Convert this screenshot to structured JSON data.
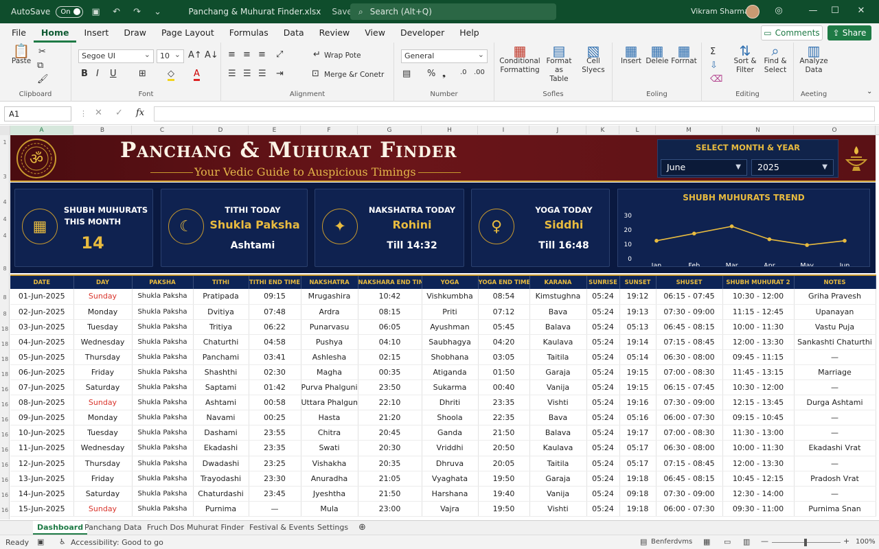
{
  "titlebar": {
    "autosave_label": "AutoSave",
    "autosave_state": "On",
    "doc_title": "Panchang & Muhurat Finder.xlsx",
    "doc_status": "Saved",
    "search_placeholder": "Search (Alt+Q)",
    "user_name": "Vikram Sharma"
  },
  "ribbon_tabs": [
    "File",
    "Home",
    "Insert",
    "Draw",
    "Page Layout",
    "Formulas",
    "Data",
    "Review",
    "View",
    "Developer",
    "Help"
  ],
  "actions": {
    "comments": "Comments",
    "share": "Share"
  },
  "ribbon": {
    "clipboard": {
      "paste": "Paste",
      "group": "Clipboard"
    },
    "font": {
      "name": "Segoe UI",
      "size": "10",
      "group": "Font"
    },
    "alignment": {
      "wrap": "Wrap Pote",
      "merge": "Merge &r Conetr",
      "group": "Alignment"
    },
    "number": {
      "format": "General",
      "group": "Number"
    },
    "styles": {
      "cond1": "Conditional",
      "cond2": "Formatting",
      "fmt1": "Format as",
      "fmt2": "Table",
      "cell1": "Cell",
      "cell2": "Slyecs",
      "group": "Sofles"
    },
    "cells": {
      "insert": "Insert",
      "delete": "Deleie",
      "format": "Forrnat",
      "group": "Eoling"
    },
    "editing": {
      "sort1": "Sort &",
      "sort2": "Filter",
      "find1": "Find &",
      "find2": "Select",
      "group": "Editing"
    },
    "analysis": {
      "analyze1": "Analyze",
      "analyze2": "Data",
      "group": "Aeeting"
    }
  },
  "formula_bar": {
    "name_box": "A1",
    "fx": "fx",
    "value": ""
  },
  "columns": [
    "A",
    "B",
    "C",
    "D",
    "E",
    "F",
    "G",
    "H",
    "I",
    "J",
    "K",
    "L",
    "M",
    "N",
    "O"
  ],
  "row_numbers": [
    "1",
    "3",
    "4",
    "4",
    "4",
    "8",
    "8",
    "8",
    "18",
    "18",
    "18",
    "18",
    "16",
    "16",
    "16",
    "16",
    "16",
    "16",
    "16",
    "16",
    "16"
  ],
  "banner": {
    "title": "Panchang & Muhurat Finder",
    "subtitle": "Your Vedic Guide to Auspicious Timings",
    "select_label": "SELECT MONTH & YEAR",
    "month": "June",
    "year": "2025",
    "om_symbol": "ॐ"
  },
  "kpis": {
    "muhurat": {
      "title1": "SHUBH MUHURATS",
      "title2": "THIS MONTH",
      "value": "14",
      "icon": "calendar-icon"
    },
    "tithi": {
      "title": "TITHI TODAY",
      "value": "Shukla Paksha",
      "sub": "Ashtami",
      "icon": "moon-icon"
    },
    "nakshatra": {
      "title": "NAKSHATRA TODAY",
      "value": "Rohini",
      "sub": "Till 14:32",
      "icon": "stars-icon"
    },
    "yoga": {
      "title": "YOGA TODAY",
      "value": "Siddhi",
      "sub": "Till 16:48",
      "icon": "meditation-icon"
    }
  },
  "chart_data": {
    "type": "line",
    "title": "SHUBH MUHURATS TREND",
    "categories": [
      "Jan",
      "Feb",
      "Mar",
      "Apr",
      "May",
      "Jun"
    ],
    "values": [
      12,
      17,
      22,
      13,
      9,
      12
    ],
    "ylim": [
      0,
      30
    ],
    "yticks": [
      "0",
      "10",
      "20",
      "30"
    ],
    "grid": false,
    "color": "#e8bb3f"
  },
  "table": {
    "headers": [
      "DATE",
      "DAY",
      "PAKSHA",
      "TITHI",
      "TITHI END TIME",
      "NAKSHATRA",
      "NAKSHARA END TIME",
      "YOGA",
      "YOGA END TIME",
      "KARANA",
      "SUNRISE",
      "SUNSET",
      "SHUSET",
      "SHUBH MUHURAT 2",
      "NOTES"
    ],
    "rows": [
      [
        "01-Jun-2025",
        "Sunday",
        "Shukla Paksha",
        "Pratipada",
        "09:15",
        "Mrugashira",
        "10:42",
        "Vishkumbha",
        "08:54",
        "Kimstughna",
        "05:24",
        "19:12",
        "06:15 - 07:45",
        "10:30 - 12:00",
        "Griha Pravesh"
      ],
      [
        "02-Jun-2025",
        "Monday",
        "Shukla Paksha",
        "Dvitiya",
        "07:48",
        "Ardra",
        "08:15",
        "Priti",
        "07:12",
        "Bava",
        "05:24",
        "19:13",
        "07:30 - 09:00",
        "11:15 - 12:45",
        "Upanayan"
      ],
      [
        "03-Jun-2025",
        "Tuesday",
        "Shukla Paksha",
        "Tritiya",
        "06:22",
        "Punarvasu",
        "06:05",
        "Ayushman",
        "05:45",
        "Balava",
        "05:24",
        "05:13",
        "06:45 - 08:15",
        "10:00 - 11:30",
        "Vastu Puja"
      ],
      [
        "04-Jun-2025",
        "Wednesday",
        "Shukla Paksha",
        "Chaturthi",
        "04:58",
        "Pushya",
        "04:10",
        "Saubhagya",
        "04:20",
        "Kaulava",
        "05:24",
        "19:14",
        "07:15 - 08:45",
        "12:00 - 13:30",
        "Sankashti Chaturthi"
      ],
      [
        "05-Jun-2025",
        "Thursday",
        "Shukla Paksha",
        "Panchami",
        "03:41",
        "Ashlesha",
        "02:15",
        "Shobhana",
        "03:05",
        "Taitila",
        "05:24",
        "05:14",
        "06:30 - 08:00",
        "09:45 - 11:15",
        "—"
      ],
      [
        "06-Jun-2025",
        "Friday",
        "Shukla Paksha",
        "Shashthi",
        "02:30",
        "Magha",
        "00:35",
        "Atiganda",
        "01:50",
        "Garaja",
        "05:24",
        "19:15",
        "07:00 - 08:30",
        "11:45 - 13:15",
        "Marriage"
      ],
      [
        "07-Jun-2025",
        "Saturday",
        "Shukla Paksha",
        "Saptami",
        "01:42",
        "Purva Phalguni",
        "23:50",
        "Sukarma",
        "00:40",
        "Vanija",
        "05:24",
        "19:15",
        "06:15 - 07:45",
        "10:30 - 12:00",
        "—"
      ],
      [
        "08-Jun-2025",
        "Sunday",
        "Shukla Paksha",
        "Ashtami",
        "00:58",
        "Uttara Phalguni",
        "22:10",
        "Dhriti",
        "23:35",
        "Vishti",
        "05:24",
        "19:16",
        "07:30 - 09:00",
        "12:15 - 13:45",
        "Durga Ashtami"
      ],
      [
        "09-Jun-2025",
        "Monday",
        "Shukla Paksha",
        "Navami",
        "00:25",
        "Hasta",
        "21:20",
        "Shoola",
        "22:35",
        "Bava",
        "05:24",
        "05:16",
        "06:00 - 07:30",
        "09:15 - 10:45",
        "—"
      ],
      [
        "10-Jun-2025",
        "Tuesday",
        "Shukla Paksha",
        "Dashami",
        "23:55",
        "Chitra",
        "20:45",
        "Ganda",
        "21:50",
        "Balava",
        "05:24",
        "19:17",
        "07:00 - 08:30",
        "11:30 - 13:00",
        "—"
      ],
      [
        "11-Jun-2025",
        "Wednesday",
        "Shukla Paksha",
        "Ekadashi",
        "23:35",
        "Swati",
        "20:30",
        "Vriddhi",
        "20:50",
        "Kaulava",
        "05:24",
        "05:17",
        "06:30 - 08:00",
        "10:00 - 11:30",
        "Ekadashi Vrat"
      ],
      [
        "12-Jun-2025",
        "Thursday",
        "Shukla Paksha",
        "Dwadashi",
        "23:25",
        "Vishakha",
        "20:35",
        "Dhruva",
        "20:05",
        "Taitila",
        "05:24",
        "05:17",
        "07:15 - 08:45",
        "12:00 - 13:30",
        "—"
      ],
      [
        "13-Jun-2025",
        "Friday",
        "Shukla Paksha",
        "Trayodashi",
        "23:30",
        "Anuradha",
        "21:05",
        "Vyaghata",
        "19:50",
        "Garaja",
        "05:24",
        "19:18",
        "06:45 - 08:15",
        "10:45 - 12:15",
        "Pradosh Vrat"
      ],
      [
        "14-Jun-2025",
        "Saturday",
        "Shukla Paksha",
        "Chaturdashi",
        "23:45",
        "Jyeshtha",
        "21:50",
        "Harshana",
        "19:40",
        "Vanija",
        "05:24",
        "09:18",
        "07:30 - 09:00",
        "12:30 - 14:00",
        "—"
      ],
      [
        "15-Jun-2025",
        "Sunday",
        "Shukla Paksha",
        "Purnima",
        "—",
        "Mula",
        "23:00",
        "Vajra",
        "19:50",
        "Vishti",
        "05:24",
        "19:18",
        "06:00 - 07:30",
        "09:30 - 11:00",
        "Purnima Snan"
      ]
    ]
  },
  "sheets": [
    "Dashboard",
    "Panchang Data",
    "Fruch Dos",
    "Muhurat Finder",
    "Festival & Events",
    "Settings"
  ],
  "status": {
    "ready": "Ready",
    "accessibility": "Accessibility: Good to go",
    "display": "Benferdvms",
    "zoom": "100%"
  }
}
